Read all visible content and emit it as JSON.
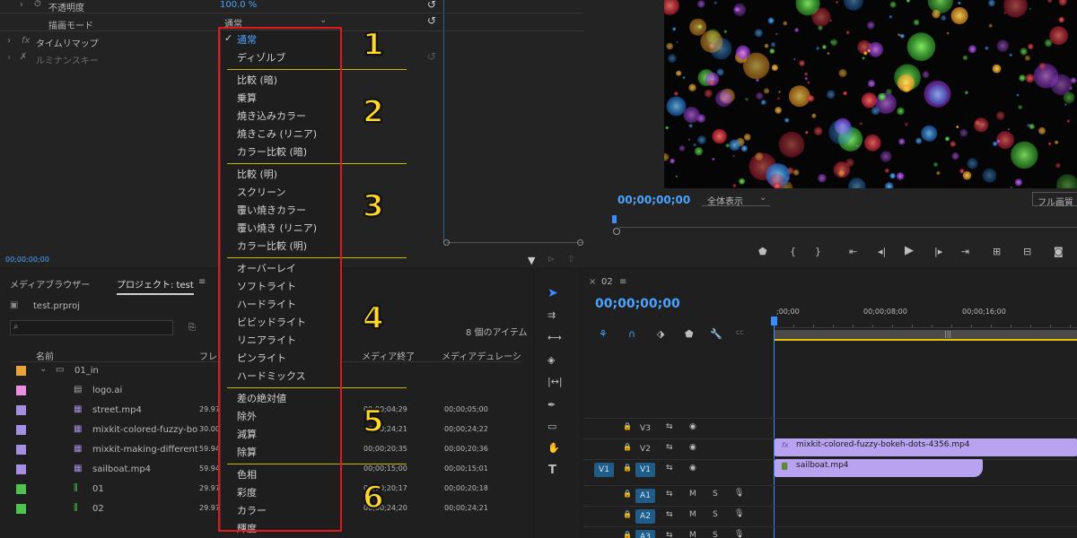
{
  "effect_controls": {
    "opacity_label": "不透明度",
    "opacity_value": "100.0 %",
    "blend_label": "描画モード",
    "blend_value": "通常",
    "time_remap": "タイムリマップ",
    "lumetri_key": "ルミナンスキー",
    "timecode": "00;00;00;00"
  },
  "blend_menu": {
    "groups": [
      {
        "number": "1",
        "items": [
          "通常",
          "ディゾルブ"
        ]
      },
      {
        "number": "2",
        "items": [
          "比較 (暗)",
          "乗算",
          "焼き込みカラー",
          "焼きこみ (リニア)",
          "カラー比較 (暗)"
        ]
      },
      {
        "number": "3",
        "items": [
          "比較 (明)",
          "スクリーン",
          "覆い焼きカラー",
          "覆い焼き (リニア)",
          "カラー比較 (明)"
        ]
      },
      {
        "number": "4",
        "items": [
          "オーバーレイ",
          "ソフトライト",
          "ハードライト",
          "ビビッドライト",
          "リニアライト",
          "ピンライト",
          "ハードミックス"
        ]
      },
      {
        "number": "5",
        "items": [
          "差の絶対値",
          "除外",
          "減算",
          "除算"
        ]
      },
      {
        "number": "6",
        "items": [
          "色相",
          "彩度",
          "カラー",
          "輝度"
        ]
      }
    ],
    "selected": "通常"
  },
  "program_monitor": {
    "timecode": "00;00;00;00",
    "zoom": "全体表示",
    "quality": "フル画質"
  },
  "project_panel": {
    "tabs": [
      "メディアブラウザー",
      "プロジェクト: test"
    ],
    "project_file": "test.prproj",
    "item_count": "8 個のアイテム",
    "columns": [
      "名前",
      "フレー",
      "メディア終了",
      "メディアデュレーシ"
    ],
    "rows": [
      {
        "color": "#e8a33a",
        "name": "01_in",
        "fps": "",
        "end": "",
        "dur": "",
        "kind": "folder"
      },
      {
        "color": "#e88fe0",
        "name": "logo.ai",
        "fps": "",
        "end": "",
        "dur": "",
        "kind": "image"
      },
      {
        "color": "#a58fe0",
        "name": "street.mp4",
        "fps": "29.97",
        "end": "00;00;04;29",
        "dur": "00;00;05;00",
        "kind": "video"
      },
      {
        "color": "#a58fe0",
        "name": "mixkit-colored-fuzzy-bo",
        "fps": "30.00",
        "end": "00;00;24;21",
        "dur": "00;00;24;22",
        "kind": "video"
      },
      {
        "color": "#a58fe0",
        "name": "mixkit-making-different",
        "fps": "59.94",
        "end": "00;00;20;35",
        "dur": "00;00;20;36",
        "kind": "video"
      },
      {
        "color": "#a58fe0",
        "name": "sailboat.mp4",
        "fps": "59.94",
        "end": "00;00;15;00",
        "dur": "00;00;15;01",
        "kind": "video"
      },
      {
        "color": "#4fc24f",
        "name": "01",
        "fps": "29.97",
        "end": "00;00;20;17",
        "dur": "00;00;20;18",
        "kind": "sequence"
      },
      {
        "color": "#4fc24f",
        "name": "02",
        "fps": "29.97",
        "end": "00;00;24;20",
        "dur": "00;00;24;21",
        "kind": "sequence"
      }
    ]
  },
  "timeline": {
    "sequence_name": "02",
    "timecode": "00;00;00;00",
    "ruler": [
      ";00;00",
      "00;00;08;00",
      "00;00;16;00"
    ],
    "tracks": [
      {
        "label": "V3",
        "source": ""
      },
      {
        "label": "V2",
        "source": ""
      },
      {
        "label": "V1",
        "source": "V1"
      },
      {
        "label": "A1",
        "source": ""
      },
      {
        "label": "A2",
        "source": ""
      },
      {
        "label": "A3",
        "source": ""
      }
    ],
    "clips": [
      {
        "name": "mixkit-colored-fuzzy-bokeh-dots-4356.mp4",
        "track": "V2"
      },
      {
        "name": "sailboat.mp4",
        "track": "V1"
      }
    ],
    "track_buttons": {
      "mute": "M",
      "solo": "S"
    }
  }
}
